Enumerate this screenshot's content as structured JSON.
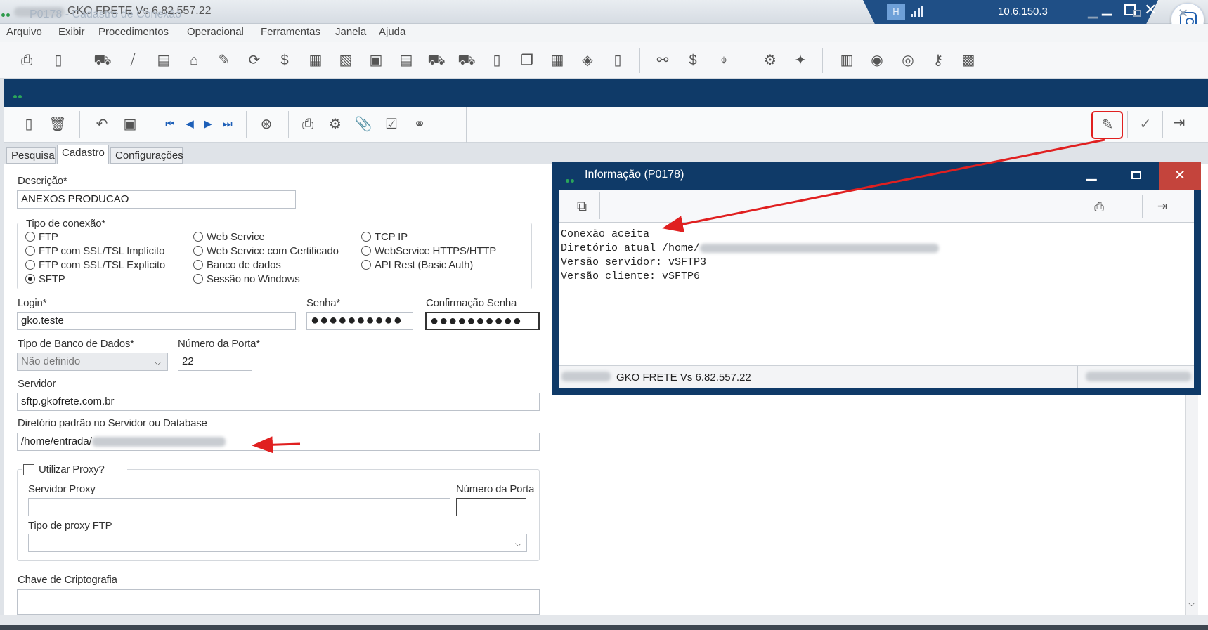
{
  "app": {
    "title": "GKO FRETE Vs 6.82.557.22",
    "remote_ip": "10.6.150.3",
    "remote_letter": "H"
  },
  "menu": [
    "Arquivo",
    "Exibir",
    "Procedimentos",
    "Operacional",
    "Ferramentas",
    "Janela",
    "Ajuda"
  ],
  "window": {
    "title": "P0178 - Cadastro de Conexão"
  },
  "tabs": [
    {
      "label": "Pesquisa"
    },
    {
      "label": "Cadastro",
      "active": true
    },
    {
      "label": "Configurações"
    }
  ],
  "form": {
    "descricao_label": "Descrição*",
    "descricao_value": "ANEXOS PRODUCAO",
    "tipo_conexao_label": "Tipo de conexão*",
    "connection_types": [
      {
        "label": "FTP",
        "selected": false
      },
      {
        "label": "FTP com SSL/TSL Implícito",
        "selected": false
      },
      {
        "label": "FTP com SSL/TSL Explícito",
        "selected": false
      },
      {
        "label": "SFTP",
        "selected": true
      },
      {
        "label": "Web Service",
        "selected": false
      },
      {
        "label": "Web Service com Certificado",
        "selected": false
      },
      {
        "label": "Banco de dados",
        "selected": false
      },
      {
        "label": "Sessão no Windows",
        "selected": false
      },
      {
        "label": "TCP IP",
        "selected": false
      },
      {
        "label": "WebService HTTPS/HTTP",
        "selected": false
      },
      {
        "label": "API Rest (Basic Auth)",
        "selected": false
      }
    ],
    "login_label": "Login*",
    "login_value": "gko.teste",
    "senha_label": "Senha*",
    "senha_value": "●●●●●●●●●●",
    "confirmacao_label": "Confirmação Senha",
    "confirmacao_value": "●●●●●●●●●●",
    "tipo_banco_label": "Tipo de Banco de Dados*",
    "tipo_banco_value": "Não definido",
    "porta_label": "Número da Porta*",
    "porta_value": "22",
    "servidor_label": "Servidor",
    "servidor_value": "sftp.gkofrete.com.br",
    "diretorio_label": "Diretório padrão no Servidor ou Database",
    "diretorio_value": "/home/entrada/",
    "proxy_label": "Utilizar Proxy?",
    "proxy_checked": false,
    "servidor_proxy_label": "Servidor Proxy",
    "servidor_proxy_value": "",
    "porta_proxy_label": "Número da Porta",
    "porta_proxy_value": "",
    "tipo_proxy_label": "Tipo de proxy FTP",
    "tipo_proxy_value": "",
    "chave_label": "Chave de Criptografia",
    "chave_value": ""
  },
  "info_dialog": {
    "title": "Informação (P0178)",
    "lines": [
      "Conexão aceita",
      "Diretório atual /home/",
      "Versão servidor: vSFTP3",
      "Versão cliente: vSFTP6"
    ],
    "status": "GKO FRETE Vs 6.82.557.22"
  },
  "accent": {
    "navy": "#0f3a68",
    "close_red": "#c4443c",
    "annotation_red": "#e02020"
  }
}
